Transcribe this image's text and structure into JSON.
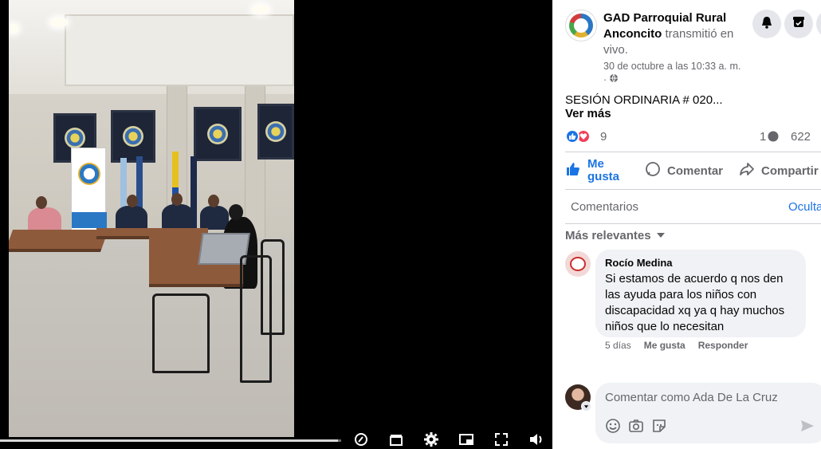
{
  "post": {
    "page_name": "GAD Parroquial Rural Anconcito",
    "action_text": "transmitió en vivo.",
    "date": "30 de octubre a las 10:33 a. m.",
    "privacy_separator": "·",
    "text": "SESIÓN ORDINARIA # 020...",
    "see_more": "Ver más"
  },
  "reactions": {
    "count": "9",
    "comments_count": "1",
    "shares_count": "622"
  },
  "actions": {
    "like": "Me gusta",
    "comment": "Comentar",
    "share": "Compartir"
  },
  "comments_section": {
    "tab_label": "Comentarios",
    "hide_label": "Ocultar",
    "sort_label": "Más relevantes"
  },
  "comments": [
    {
      "author": "Rocío Medina",
      "text": "Si estamos de acuerdo q nos den las ayuda para los niños con discapacidad xq ya q hay muchos niños que lo necesitan",
      "time": "5 días",
      "like": "Me gusta",
      "reply": "Responder"
    }
  ],
  "composer": {
    "placeholder": "Comentar como Ada De La Cruz"
  },
  "video": {
    "progress_fraction": 0.99
  },
  "colors": {
    "accent": "#1b74e4",
    "muted_text": "#65676b",
    "bubble": "#f0f2f5"
  }
}
